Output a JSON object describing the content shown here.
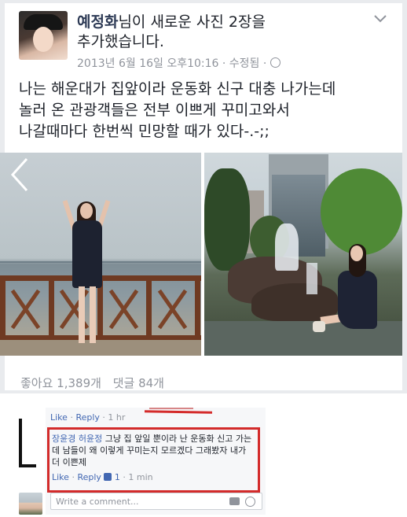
{
  "post": {
    "author": "예정화",
    "action_line1": "님이 새로운 사진 2장을",
    "action_line2": "추가했습니다.",
    "meta": "2013년 6월 16일 오후10:16 · 수정됨 ·",
    "text_line1": "나는 해운대가 집앞이라 운동화 신구 대충 나가는데",
    "text_line2": "놀러 온 관광객들은 전부 이쁘게 꾸미고와서",
    "text_line3": "나갈때마다 한번씩 민망할 때가 있다-.-;;",
    "likes": "좋아요 1,389개",
    "comments": "댓글 84개",
    "icons": {
      "menu": "chevron-down-icon",
      "privacy": "globe-icon",
      "prev": "chevron-left-icon"
    }
  },
  "comments": {
    "top_actions": {
      "like": "Like",
      "sep": "·",
      "reply": "Reply",
      "time": "· 1 hr"
    },
    "comment": {
      "author": "장윤경 허윤정",
      "text": " 그냥 집 앞일 뿐이라 난 운동화 신고 가는데 남들이 왜 이렇게 꾸미는지 모르겠다 그래봤자 내가 더 이쁜제",
      "like": "Like",
      "sep": "·",
      "reply": "Reply",
      "like_count": "1",
      "time": "· 1 min"
    },
    "write_placeholder": "Write a comment...",
    "highlight_color": "#d32b2b",
    "link_color": "#4267b2"
  }
}
